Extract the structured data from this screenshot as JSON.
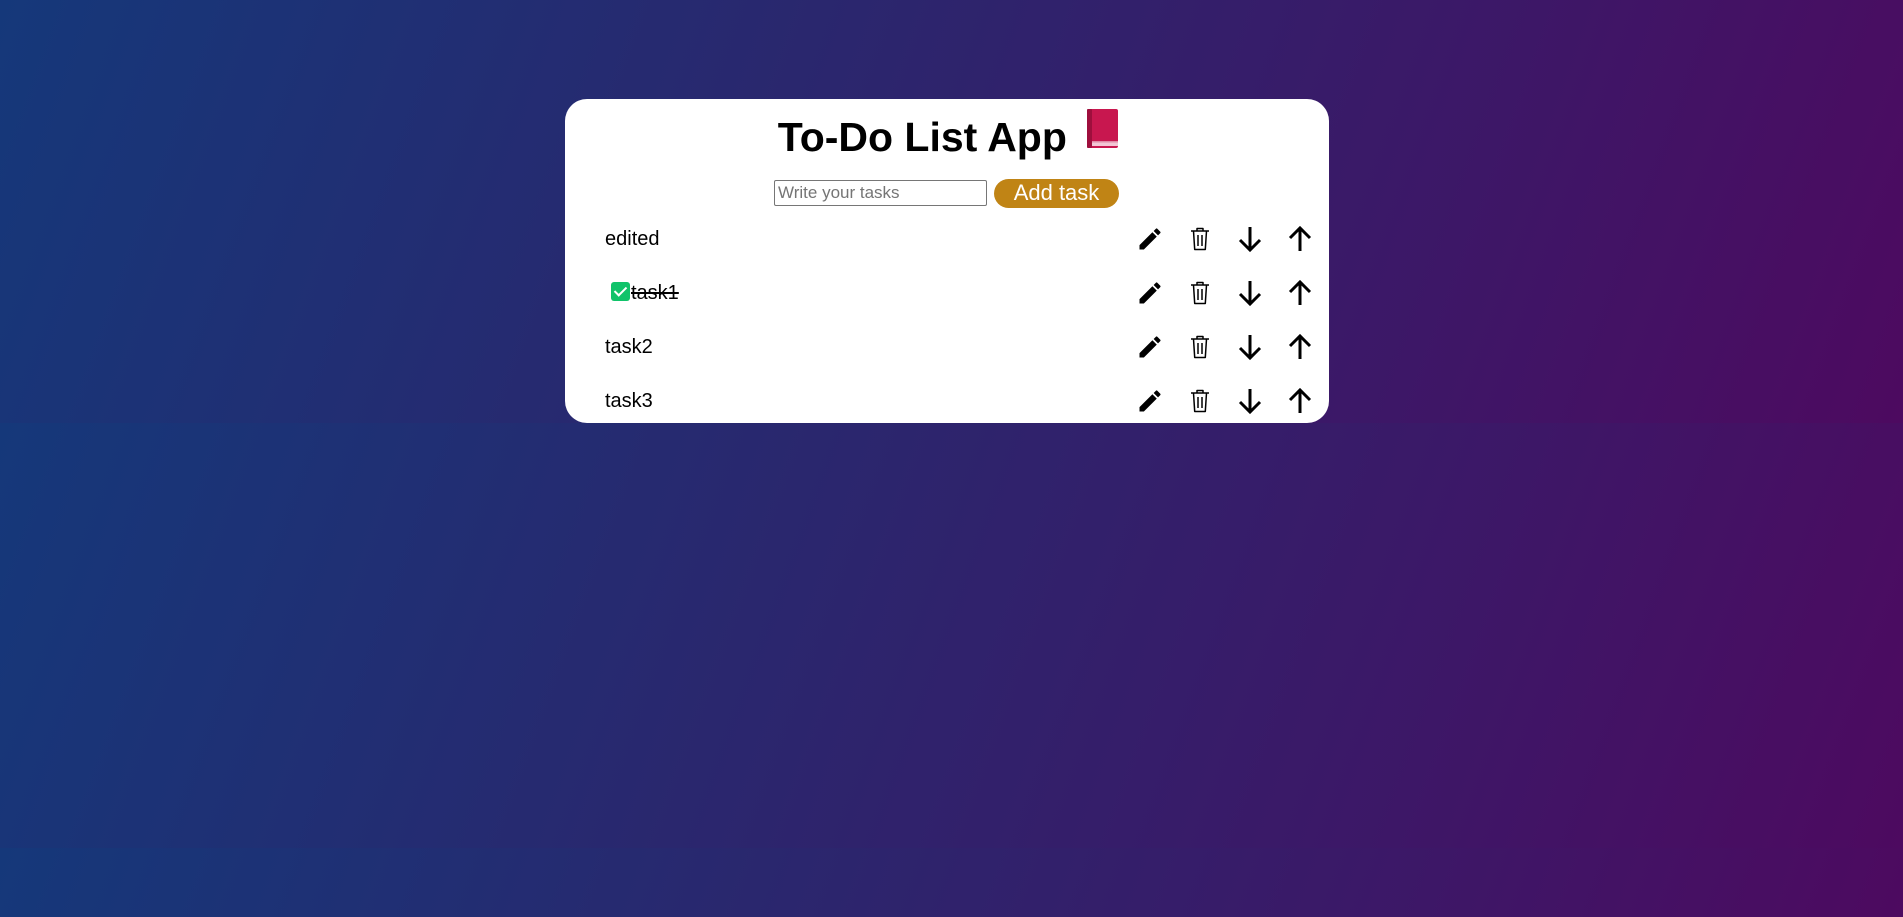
{
  "app": {
    "title": "To-Do List App",
    "title_icon": "closed-book-icon"
  },
  "add_form": {
    "input_placeholder": "Write your tasks",
    "input_value": "",
    "add_button_label": "Add task"
  },
  "colors": {
    "background_gradient": [
      "#15387a",
      "#4d0a60"
    ],
    "card": "#ffffff",
    "add_button": "#c08415",
    "checked_box": "#10c36a",
    "book_icon": "#c8174f"
  },
  "tasks": [
    {
      "text": "edited",
      "completed": false
    },
    {
      "text": "task1",
      "completed": true
    },
    {
      "text": "task2",
      "completed": false
    },
    {
      "text": "task3",
      "completed": false
    }
  ],
  "task_actions": [
    "pencil-icon",
    "trash-icon",
    "arrow-down-icon",
    "arrow-up-icon"
  ]
}
